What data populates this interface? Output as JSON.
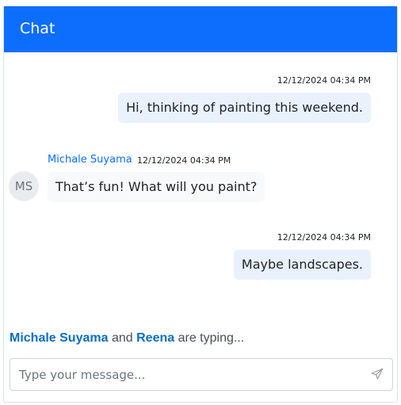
{
  "header": {
    "title": "Chat"
  },
  "messages": [
    {
      "direction": "outgoing",
      "time": "12/12/2024 04:34 PM",
      "text": "Hi, thinking of painting this weekend."
    },
    {
      "direction": "incoming",
      "author": "Michale Suyama",
      "avatar_initials": "MS",
      "time": "12/12/2024 04:34 PM",
      "text": "That’s fun! What will you paint?"
    },
    {
      "direction": "outgoing",
      "time": "12/12/2024 04:34 PM",
      "text": "Maybe landscapes."
    }
  ],
  "typing_indicator": {
    "user1": "Michale Suyama",
    "connector": "and",
    "user2": "Reena",
    "suffix": "are typing..."
  },
  "input": {
    "placeholder": "Type your message...",
    "value": ""
  },
  "icons": {
    "send": "send-icon"
  },
  "colors": {
    "header": "#0d6efd",
    "outgoing_bubble": "#e9f1fd",
    "incoming_bubble": "#f8f9fa",
    "author": "#0d6efd",
    "typing_user": "#0a6fc2"
  }
}
